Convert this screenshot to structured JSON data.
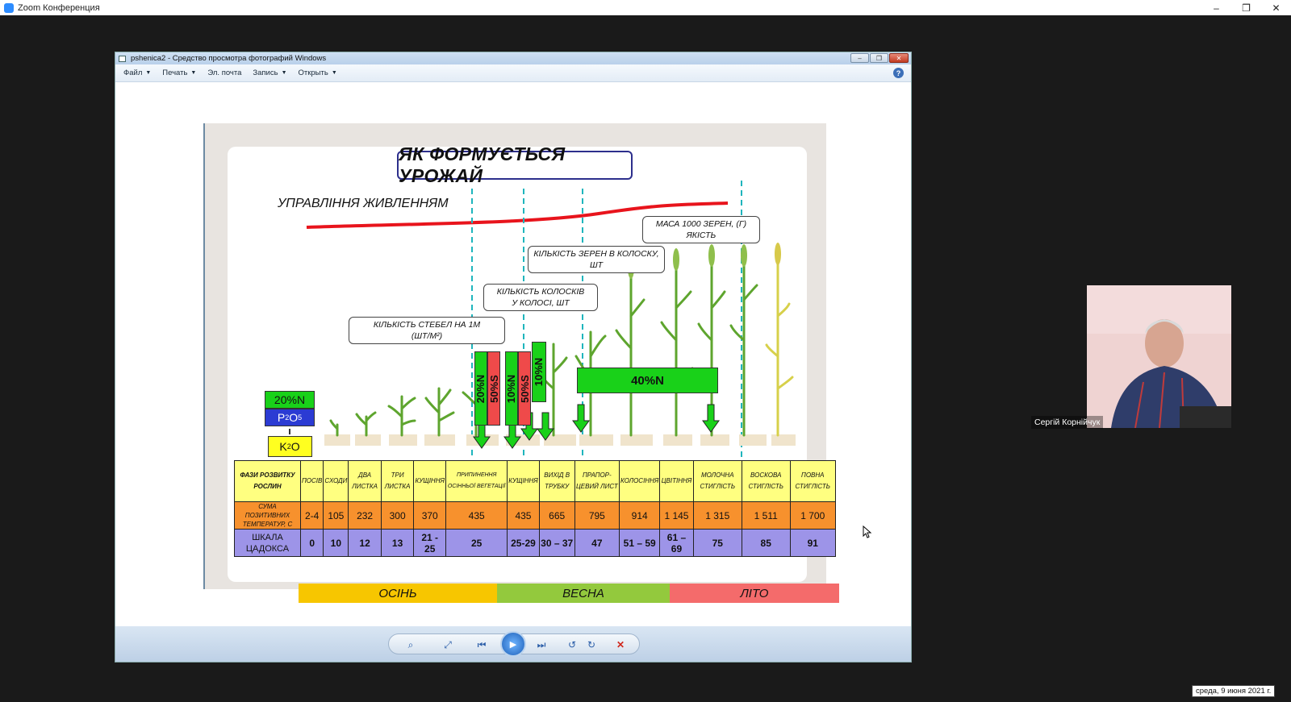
{
  "zoom": {
    "title": "Zoom Конференция",
    "minimize": "–",
    "restore": "❐",
    "close": "✕"
  },
  "viewer": {
    "title": "pshenica2 - Средство просмотра фотографий Windows",
    "menu": [
      {
        "label": "Файл",
        "caret": true
      },
      {
        "label": "Печать",
        "caret": true
      },
      {
        "label": "Эл. почта",
        "caret": false
      },
      {
        "label": "Запись",
        "caret": true
      },
      {
        "label": "Открыть",
        "caret": true
      }
    ],
    "help": "?",
    "controls": [
      "zoom-icon",
      "fit-icon",
      "prev-icon",
      "slideshow-icon",
      "next-icon",
      "rotate-left-icon",
      "rotate-right-icon",
      "delete-icon"
    ]
  },
  "slide": {
    "title": "ЯК ФОРМУЄТЬСЯ УРОЖАЙ",
    "subtitle": "УПРАВЛІННЯ ЖИВЛЕННЯМ",
    "callouts": {
      "stems_line1": "КІЛЬКІСТЬ СТЕБЕЛ НА 1М",
      "stems_line2": "(ШТ/М²)",
      "spikelets_line1": "КІЛЬКІСТЬ КОЛОСКІВ",
      "spikelets_line2": "У КОЛОСІ, ШТ",
      "grains_line1": "КІЛЬКІСТЬ ЗЕРЕН В КОЛОСКУ,",
      "grains_line2": "ШТ",
      "mass_line1": "МАСА  1000 ЗЕРЕН, (Г)",
      "mass_line2": "ЯКІСТЬ"
    },
    "fertilizers": {
      "n20": "20%N",
      "p2o5": "P",
      "p_sub": "2",
      "o_label": "O",
      "o_sub": "5",
      "k2o": "K",
      "k_sub": "2",
      "k_o": "O",
      "bar1_n": "20%N",
      "bar1_s": "50%S",
      "bar2_n": "10%N",
      "bar2_s": "50%S",
      "bar3_n": "10%N",
      "bar4": "40%N"
    },
    "table": {
      "row1_header": "ФАЗИ РОЗВИТКУ РОСЛИН",
      "row2_header": "СУМА ПОЗИТИВНИХ ТЕМПЕРАТУР, С",
      "row3_header": "ШКАЛА ЦАДОКСА",
      "phases": [
        "ПОСІВ",
        "СХОДИ",
        "ДВА ЛИСТКА",
        "ТРИ ЛИСТКА",
        "КУЩІННЯ",
        "ПРИПИНЕННЯ ОСІННЬОЇ ВЕГЕТАЦІЇ",
        "КУЩІННЯ",
        "ВИХІД В ТРУБКУ",
        "ПРАПОР-ЦЕВИЙ ЛИСТ",
        "КОЛОСІННЯ",
        "ЦВІТІННЯ",
        "МОЛОЧНА СТИГЛІСТЬ",
        "ВОСКОВА СТИГЛІСТЬ",
        "ПОВНА СТИГЛІСТЬ"
      ],
      "temps": [
        "2-4",
        "105",
        "232",
        "300",
        "370",
        "435",
        "435",
        "665",
        "795",
        "914",
        "1 145",
        "1 315",
        "1 511",
        "1 700"
      ],
      "zadoks": [
        "0",
        "10",
        "12",
        "13",
        "21 - 25",
        "25",
        "25-29",
        "30 – 37",
        "47",
        "51 – 59",
        "61 – 69",
        "75",
        "85",
        "91"
      ]
    },
    "seasons": [
      {
        "label": "ОСІНЬ",
        "color": "#f7c600"
      },
      {
        "label": "ВЕСНА",
        "color": "#93c93d"
      },
      {
        "label": "ЛІТО",
        "color": "#f46b6b"
      }
    ]
  },
  "participant": {
    "name": "Сергій Корнійчук"
  },
  "tooltip": {
    "date": "среда, 9 июня 2021 г."
  }
}
